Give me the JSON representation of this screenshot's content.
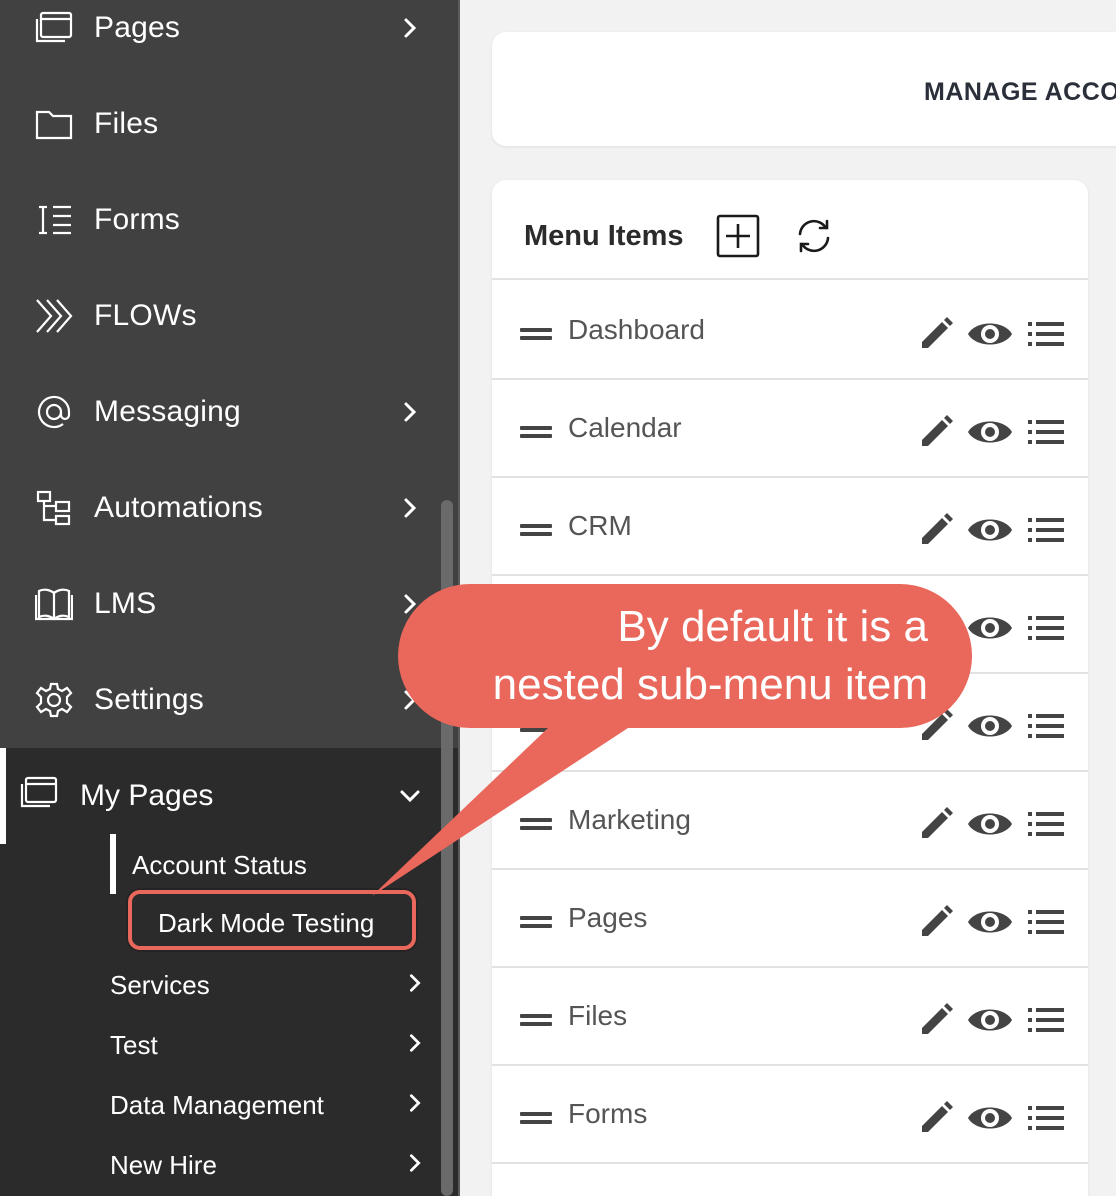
{
  "sidebar": {
    "items": [
      {
        "label": "Pages",
        "icon": "pages-icon",
        "has_chevron": true
      },
      {
        "label": "Files",
        "icon": "folder-icon",
        "has_chevron": false
      },
      {
        "label": "Forms",
        "icon": "forms-icon",
        "has_chevron": false
      },
      {
        "label": "FLOWs",
        "icon": "flows-icon",
        "has_chevron": false
      },
      {
        "label": "Messaging",
        "icon": "at-icon",
        "has_chevron": true
      },
      {
        "label": "Automations",
        "icon": "automations-icon",
        "has_chevron": true
      },
      {
        "label": "LMS",
        "icon": "book-icon",
        "has_chevron": true
      },
      {
        "label": "Settings",
        "icon": "gear-icon",
        "has_chevron": true
      }
    ],
    "my_pages": {
      "label": "My Pages",
      "icon": "pages-icon",
      "expanded": true,
      "children": [
        {
          "label": "Account Status",
          "active": true
        },
        {
          "label": "Dark Mode Testing",
          "highlighted": true
        },
        {
          "label": "Services"
        },
        {
          "label": "Test"
        },
        {
          "label": "Data Management"
        },
        {
          "label": "New Hire"
        }
      ]
    }
  },
  "header": {
    "title": "MANAGE ACCO"
  },
  "menu": {
    "title": "Menu Items",
    "items": [
      "Dashboard",
      "Calendar",
      "CRM",
      "",
      "",
      "Marketing",
      "Pages",
      "Files",
      "Forms"
    ]
  },
  "callout": {
    "line1": "By default it is a",
    "line2": "nested sub-menu item",
    "color": "#e9675b"
  }
}
